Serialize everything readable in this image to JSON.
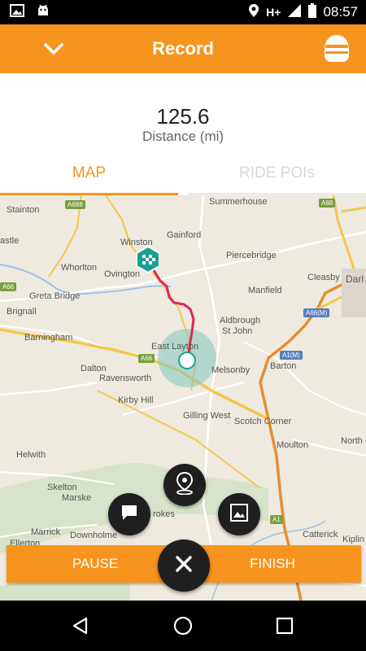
{
  "status_bar": {
    "network": "H+",
    "time": "08:57",
    "icons": [
      "gallery-icon",
      "android-icon",
      "location-icon",
      "signal-icon",
      "battery-icon"
    ]
  },
  "app_bar": {
    "title": "Record",
    "back_icon": "chevron-down-icon",
    "profile_icon": "helmet-icon"
  },
  "stats": {
    "value": "125.6",
    "label": "Distance (mi)"
  },
  "tabs": [
    {
      "label": "MAP",
      "active": true
    },
    {
      "label": "RIDE POIs",
      "active": false
    }
  ],
  "map": {
    "places": [
      {
        "name": "Stainton"
      },
      {
        "name": "Summerhouse"
      },
      {
        "name": "astle"
      },
      {
        "name": "Winston"
      },
      {
        "name": "Gainford"
      },
      {
        "name": "Darl"
      },
      {
        "name": "Whorlton"
      },
      {
        "name": "Ovington"
      },
      {
        "name": "Piercebridge"
      },
      {
        "name": "Greta Bridge"
      },
      {
        "name": "Manfield"
      },
      {
        "name": "Cleasby"
      },
      {
        "name": "Brignall"
      },
      {
        "name": "Aldbrough"
      },
      {
        "name": "St John"
      },
      {
        "name": "Barningham"
      },
      {
        "name": "East Layton"
      },
      {
        "name": "Barton"
      },
      {
        "name": "Dalton"
      },
      {
        "name": "Ravensworth"
      },
      {
        "name": "Melsonby"
      },
      {
        "name": "Kirby Hill"
      },
      {
        "name": "Gilling West"
      },
      {
        "name": "Scotch Corner"
      },
      {
        "name": "North C"
      },
      {
        "name": "Helwith"
      },
      {
        "name": "Moulton"
      },
      {
        "name": "Skelton"
      },
      {
        "name": "Marske"
      },
      {
        "name": "Marrick"
      },
      {
        "name": "Ellerton"
      },
      {
        "name": "Downholme"
      },
      {
        "name": "Catterick"
      },
      {
        "name": "Kiplin"
      },
      {
        "name": "rokes"
      }
    ],
    "roads": [
      {
        "name": "A688"
      },
      {
        "name": "A68"
      },
      {
        "name": "A66"
      },
      {
        "name": "A66"
      },
      {
        "name": "A66(M)"
      },
      {
        "name": "A1(M)"
      },
      {
        "name": "A1"
      }
    ],
    "start_marker_icon": "checkered-flag-icon",
    "current_position_icon": "location-dot-icon"
  },
  "actions": {
    "pause_label": "PAUSE",
    "finish_label": "FINISH",
    "close_icon": "close-icon",
    "poi_icon": "map-pin-icon",
    "comment_icon": "comment-icon",
    "photo_icon": "photo-icon"
  },
  "colors": {
    "accent": "#f7941d",
    "route": "#e0245e",
    "marker": "#1aa090"
  }
}
